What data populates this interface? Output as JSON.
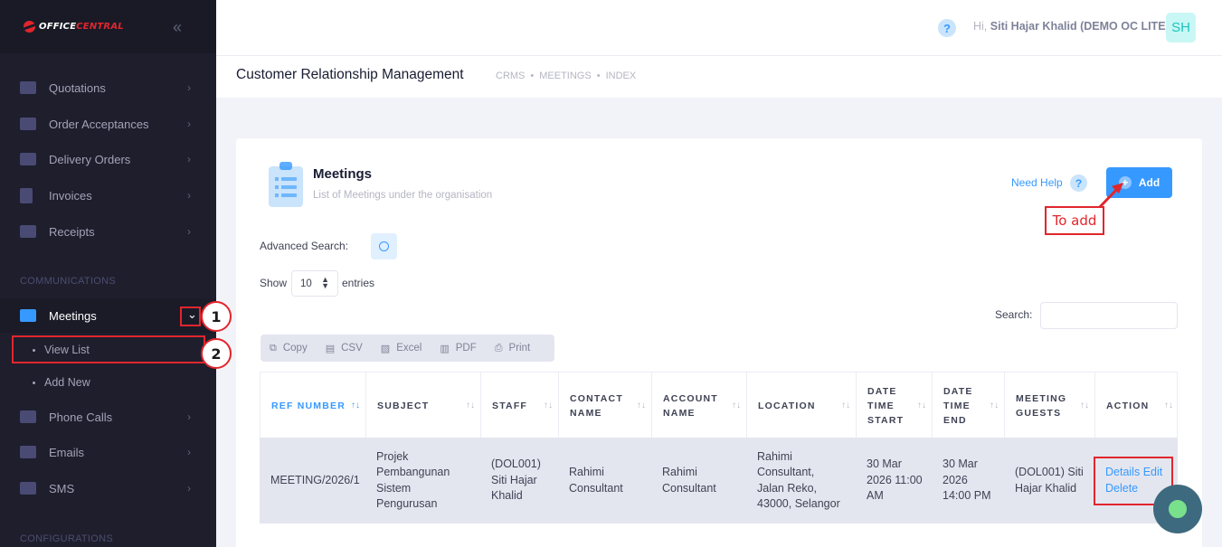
{
  "brand": {
    "name_part1": "OFFICE",
    "name_part2": "CENTRAL"
  },
  "sidebar": {
    "items_top": [
      {
        "label": "Quotations"
      },
      {
        "label": "Order Acceptances"
      },
      {
        "label": "Delivery Orders"
      },
      {
        "label": "Invoices"
      },
      {
        "label": "Receipts"
      }
    ],
    "section_communications": "COMMUNICATIONS",
    "meetings": {
      "label": "Meetings",
      "expand_glyph": "⌄"
    },
    "meetings_sub": [
      {
        "label": "View List"
      },
      {
        "label": "Add New"
      }
    ],
    "items_bottom": [
      {
        "label": "Phone Calls"
      },
      {
        "label": "Emails"
      },
      {
        "label": "SMS"
      }
    ],
    "section_configurations": "CONFIGURATIONS"
  },
  "annotations": {
    "badge1": "1",
    "badge2": "2",
    "callout": "To add"
  },
  "header": {
    "help": "?",
    "greeting_prefix": "Hi,",
    "user_name": "Siti Hajar Khalid (DEMO OC LITE)",
    "avatar_initials": "SH"
  },
  "subheader": {
    "title": "Customer Relationship Management",
    "breadcrumbs": [
      "CRMS",
      "MEETINGS",
      "INDEX"
    ]
  },
  "card": {
    "title": "Meetings",
    "subtitle": "List of Meetings under the organisation",
    "need_help": "Need Help",
    "add_label": "Add",
    "advanced_search": "Advanced Search:",
    "show": "Show",
    "entries_value": "10",
    "entries": "entries",
    "search_label": "Search:",
    "exports": [
      "Copy",
      "CSV",
      "Excel",
      "PDF",
      "Print"
    ]
  },
  "table": {
    "headers": [
      [
        "REF NUMBER"
      ],
      [
        "SUBJECT"
      ],
      [
        "STAFF"
      ],
      [
        "CONTACT",
        "NAME"
      ],
      [
        "ACCOUNT",
        "NAME"
      ],
      [
        "LOCATION"
      ],
      [
        "DATE",
        "TIME",
        "START"
      ],
      [
        "DATE",
        "TIME",
        "END"
      ],
      [
        "MEETING",
        "GUESTS"
      ],
      [
        "ACTION"
      ]
    ],
    "row": {
      "ref": "MEETING/2026/1",
      "subject": [
        "Projek",
        "Pembangunan",
        "Sistem",
        "Pengurusan"
      ],
      "staff": [
        "(DOL001)",
        "Siti Hajar",
        "Khalid"
      ],
      "contact": [
        "Rahimi",
        "Consultant"
      ],
      "account": [
        "Rahimi",
        "Consultant"
      ],
      "location": [
        "Rahimi",
        "Consultant,",
        "Jalan Reko,",
        "43000, Selangor"
      ],
      "start": [
        "30 Mar",
        "2026 11:00",
        "AM"
      ],
      "end": [
        "30 Mar",
        "2026",
        "14:00 PM"
      ],
      "guests": [
        "(DOL001) Siti",
        "Hajar Khalid"
      ],
      "actions": {
        "details": "Details",
        "edit": "Edit",
        "delete": "Delete"
      }
    }
  },
  "colors": {
    "sidebar": "#1e1e2d",
    "primary": "#3699ff",
    "annotation": "#e1262c"
  }
}
